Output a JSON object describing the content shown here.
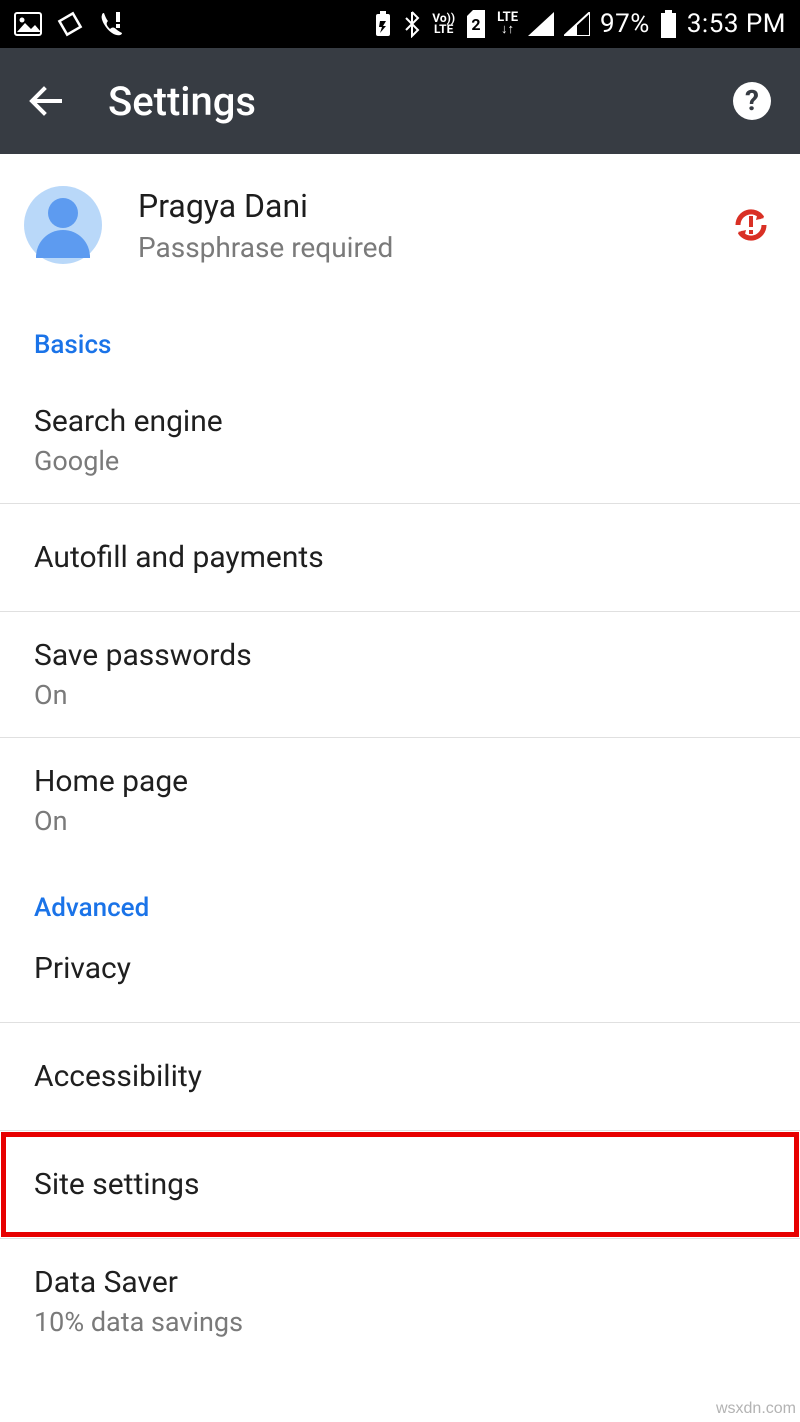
{
  "status_bar": {
    "battery_pct": "97%",
    "time": "3:53 PM",
    "sim_slot": "2",
    "lte": "LTE",
    "volte": "Vo))\nLTE"
  },
  "toolbar": {
    "title": "Settings"
  },
  "account": {
    "name": "Pragya Dani",
    "sub": "Passphrase required"
  },
  "sections": {
    "basics": {
      "header": "Basics",
      "items": [
        {
          "title": "Search engine",
          "sub": "Google"
        },
        {
          "title": "Autofill and payments"
        },
        {
          "title": "Save passwords",
          "sub": "On"
        },
        {
          "title": "Home page",
          "sub": "On"
        }
      ]
    },
    "advanced": {
      "header": "Advanced",
      "items": [
        {
          "title": "Privacy"
        },
        {
          "title": "Accessibility"
        },
        {
          "title": "Site settings"
        },
        {
          "title": "Data Saver",
          "sub": "10% data savings"
        }
      ]
    }
  },
  "watermark": "wsxdn.com"
}
